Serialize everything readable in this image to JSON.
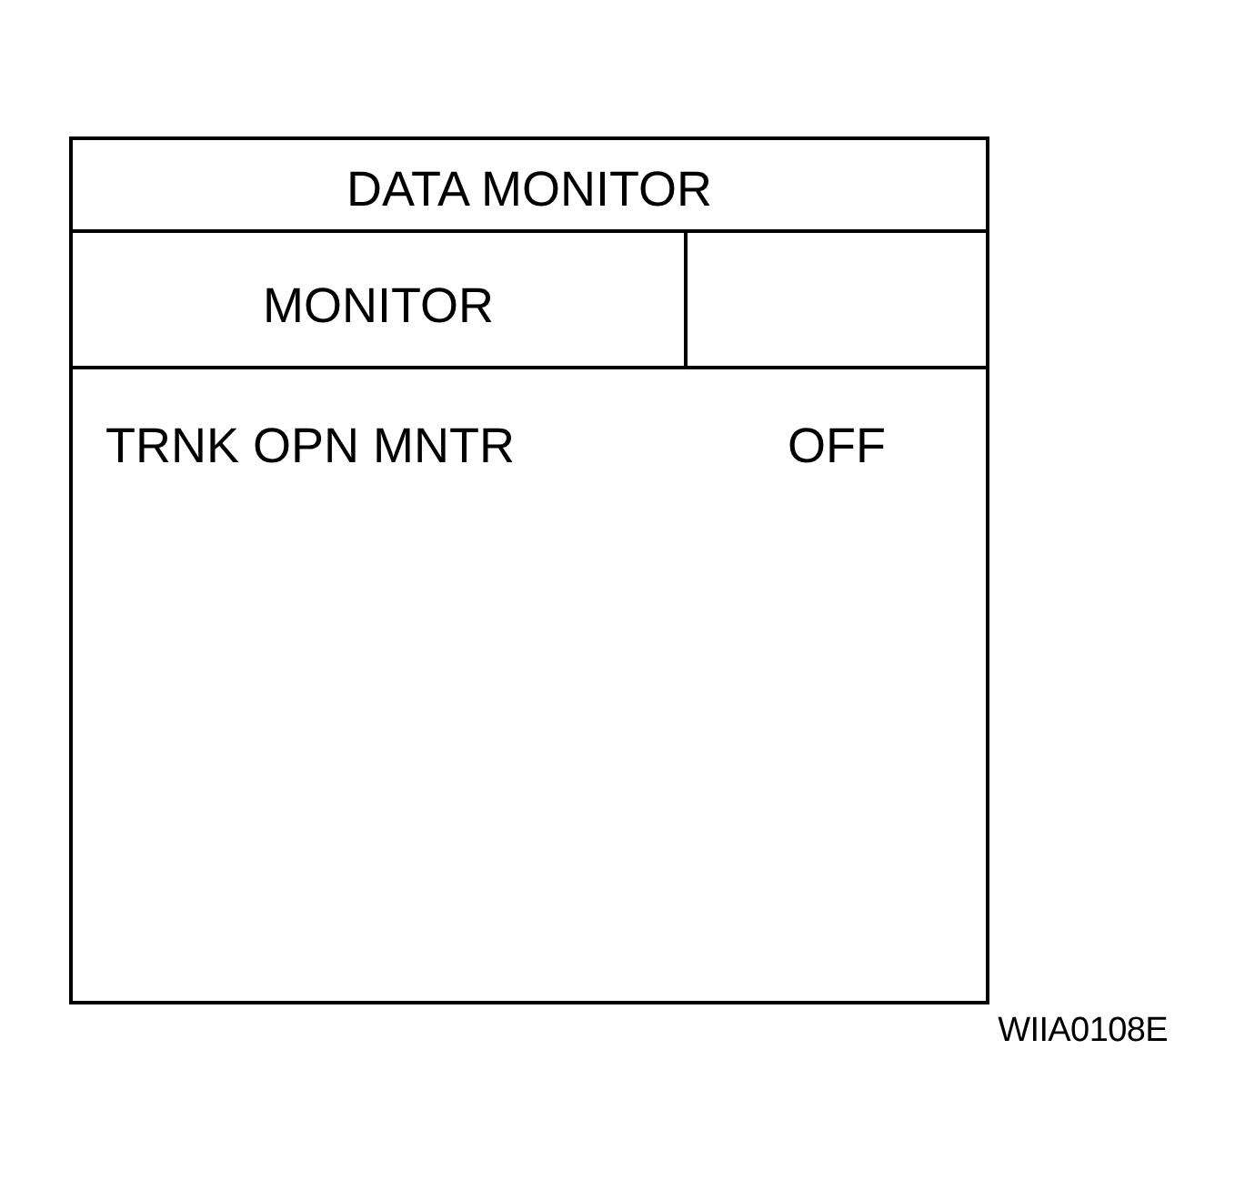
{
  "title": "DATA MONITOR",
  "header": {
    "column_1": "MONITOR"
  },
  "rows": [
    {
      "item": "TRNK OPN MNTR",
      "value": "OFF"
    }
  ],
  "figure_code": "WIIA0108E"
}
